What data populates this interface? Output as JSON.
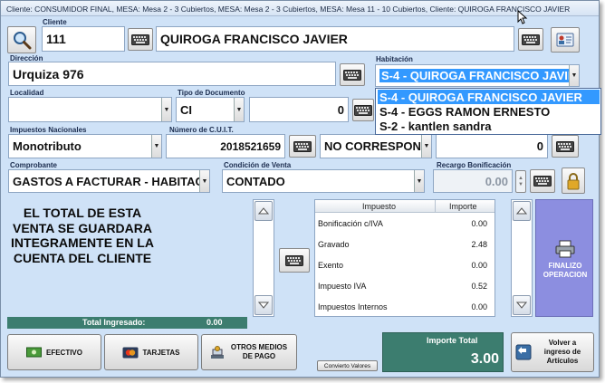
{
  "window": {
    "title": "Cliente: CONSUMIDOR FINAL, MESA: Mesa 2 - 3 Cubiertos, MESA: Mesa 2 - 3 Cubiertos, MESA: Mesa 11 - 10 Cubiertos, Cliente: QUIROGA FRANCISCO JAVIER"
  },
  "cliente": {
    "label": "Cliente",
    "code": "111",
    "name": "QUIROGA FRANCISCO JAVIER"
  },
  "direccion": {
    "label": "Dirección",
    "value": "Urquiza 976"
  },
  "habitacion": {
    "label": "Habitación",
    "selected": "S-4  - QUIROGA FRANCISCO JAVIER",
    "options": [
      "S-4  - QUIROGA FRANCISCO JAVIER",
      "S-4  - EGGS RAMON ERNESTO",
      "S-2  - kantlen sandra"
    ]
  },
  "localidad": {
    "label": "Localidad",
    "value": ""
  },
  "tipo_documento": {
    "label": "Tipo de Documento",
    "value": "CI",
    "number": "0"
  },
  "impuestos_nacionales": {
    "label": "Impuestos Nacionales",
    "value": "Monotributo"
  },
  "cuit": {
    "label": "Número de C.U.I.T.",
    "value": "2018521659",
    "condicion": "NO CORRESPONDE",
    "number": "0"
  },
  "comprobante": {
    "label": "Comprobante",
    "value": "GASTOS A FACTURAR - HABITACION"
  },
  "condicion_venta": {
    "label": "Condición de Venta",
    "value": "CONTADO"
  },
  "recargo": {
    "label": "Recargo Bonificación",
    "value": "0.00"
  },
  "message": "EL TOTAL DE ESTA VENTA SE GUARDARA INTEGRAMENTE EN LA CUENTA DEL CLIENTE",
  "total_ingresado": {
    "label": "Total  Ingresado:",
    "value": "0.00"
  },
  "tax_table": {
    "headers": [
      "Impuesto",
      "Importe"
    ],
    "rows": [
      {
        "name": "Bonificación c/IVA",
        "value": "0.00"
      },
      {
        "name": "Gravado",
        "value": "2.48"
      },
      {
        "name": "Exento",
        "value": "0.00"
      },
      {
        "name": "Impuesto IVA",
        "value": "0.52"
      },
      {
        "name": "Impuestos Internos",
        "value": "0.00"
      }
    ]
  },
  "buttons": {
    "efectivo": "EFECTIVO",
    "tarjetas": "TARJETAS",
    "otros": "OTROS MEDIOS DE PAGO",
    "convierto": "Convierto Valores",
    "finalizo": "FINALIZO OPERACION",
    "volver": "Volver a ingreso de Artículos"
  },
  "importe_total": {
    "label": "Importe Total",
    "value": "3.00"
  },
  "colors": {
    "background": "#cfe2f7",
    "total_green": "#3c7d6f",
    "finalizo_purple": "#8c8ee0",
    "selection": "#3399ff"
  }
}
